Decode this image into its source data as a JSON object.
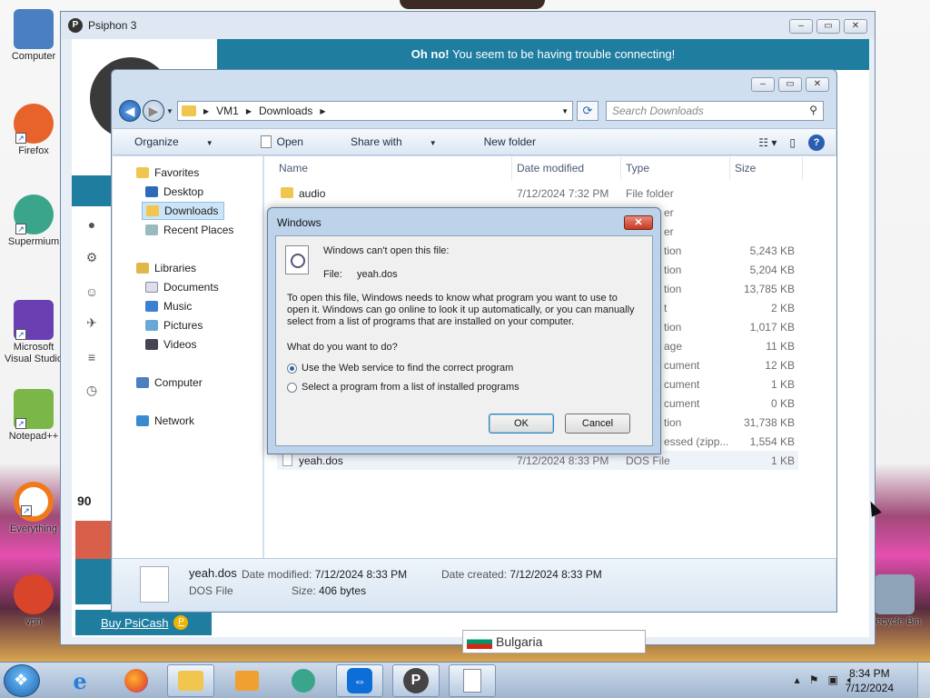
{
  "desktop": {
    "icons": [
      {
        "label": "Computer",
        "color": "#4a7fc1"
      },
      {
        "label": "Firefox",
        "color": "#e8622c"
      },
      {
        "label": "Supermium",
        "color": "#3aa58b"
      },
      {
        "label": "Microsoft Visual Studio",
        "color": "#6a3fb2"
      },
      {
        "label": "Notepad++",
        "color": "#7ab648"
      },
      {
        "label": "Everything",
        "color": "#f07a1a"
      },
      {
        "label": "vpn",
        "color": "#d9452b"
      },
      {
        "label": "Recycle Bin",
        "color": "#8fa4b8"
      }
    ]
  },
  "psiphon": {
    "title": "Psiphon 3",
    "banner_bold": "Oh no!",
    "banner_text": "You seem to be having trouble connecting!",
    "balance": "90",
    "buy_label": "Buy PsiCash",
    "region": "Bulgaria",
    "accent": "#1f7da0"
  },
  "explorer": {
    "breadcrumb": [
      "VM1",
      "Downloads"
    ],
    "search_placeholder": "Search Downloads",
    "toolbar": {
      "organize": "Organize",
      "open": "Open",
      "share_with": "Share with",
      "new_folder": "New folder"
    },
    "nav": {
      "favorites": "Favorites",
      "desktop": "Desktop",
      "downloads": "Downloads",
      "recent_places": "Recent Places",
      "libraries": "Libraries",
      "documents": "Documents",
      "music": "Music",
      "pictures": "Pictures",
      "videos": "Videos",
      "computer": "Computer",
      "network": "Network"
    },
    "columns": {
      "name": "Name",
      "date_modified": "Date modified",
      "type": "Type",
      "size": "Size"
    },
    "files": [
      {
        "name": "audio",
        "date": "7/12/2024 7:32 PM",
        "type": "File folder",
        "size": ""
      },
      {
        "name": "",
        "date": "",
        "type": "er",
        "size": ""
      },
      {
        "name": "",
        "date": "",
        "type": "er",
        "size": ""
      },
      {
        "name": "",
        "date": "",
        "type": "tion",
        "size": "5,243 KB"
      },
      {
        "name": "",
        "date": "",
        "type": "tion",
        "size": "5,204 KB"
      },
      {
        "name": "",
        "date": "",
        "type": "tion",
        "size": "13,785 KB"
      },
      {
        "name": "",
        "date": "",
        "type": "t",
        "size": "2 KB"
      },
      {
        "name": "",
        "date": "",
        "type": "tion",
        "size": "1,017 KB"
      },
      {
        "name": "",
        "date": "",
        "type": "age",
        "size": "11 KB"
      },
      {
        "name": "",
        "date": "",
        "type": "cument",
        "size": "12 KB"
      },
      {
        "name": "",
        "date": "",
        "type": "cument",
        "size": "1 KB"
      },
      {
        "name": "",
        "date": "",
        "type": "cument",
        "size": "0 KB"
      },
      {
        "name": "",
        "date": "",
        "type": "tion",
        "size": "31,738 KB"
      },
      {
        "name": "",
        "date": "",
        "type": "essed (zipp...",
        "size": "1,554 KB"
      },
      {
        "name": "yeah.dos",
        "date": "7/12/2024 8:33 PM",
        "type": "DOS File",
        "size": "1 KB"
      }
    ],
    "details": {
      "name": "yeah.dos",
      "type": "DOS File",
      "date_modified_label": "Date modified:",
      "date_modified": "7/12/2024 8:33 PM",
      "date_created_label": "Date created:",
      "date_created": "7/12/2024 8:33 PM",
      "size_label": "Size:",
      "size": "406 bytes"
    }
  },
  "dialog": {
    "title": "Windows",
    "heading": "Windows can't open this file:",
    "file_label": "File:",
    "file_name": "yeah.dos",
    "body_line1": "To open this file, Windows needs to know what program you want to use to",
    "body_line2": "open it. Windows can go online to look it up automatically, or you can manually",
    "body_line3": "select from a list of programs that are installed on your computer.",
    "question": "What do you want to do?",
    "option_web": "Use the Web service to find the correct program",
    "option_list": "Select a program from a list of installed programs",
    "selected_option": "web",
    "ok": "OK",
    "cancel": "Cancel"
  },
  "taskbar": {
    "time": "8:34 PM",
    "date": "7/12/2024"
  }
}
